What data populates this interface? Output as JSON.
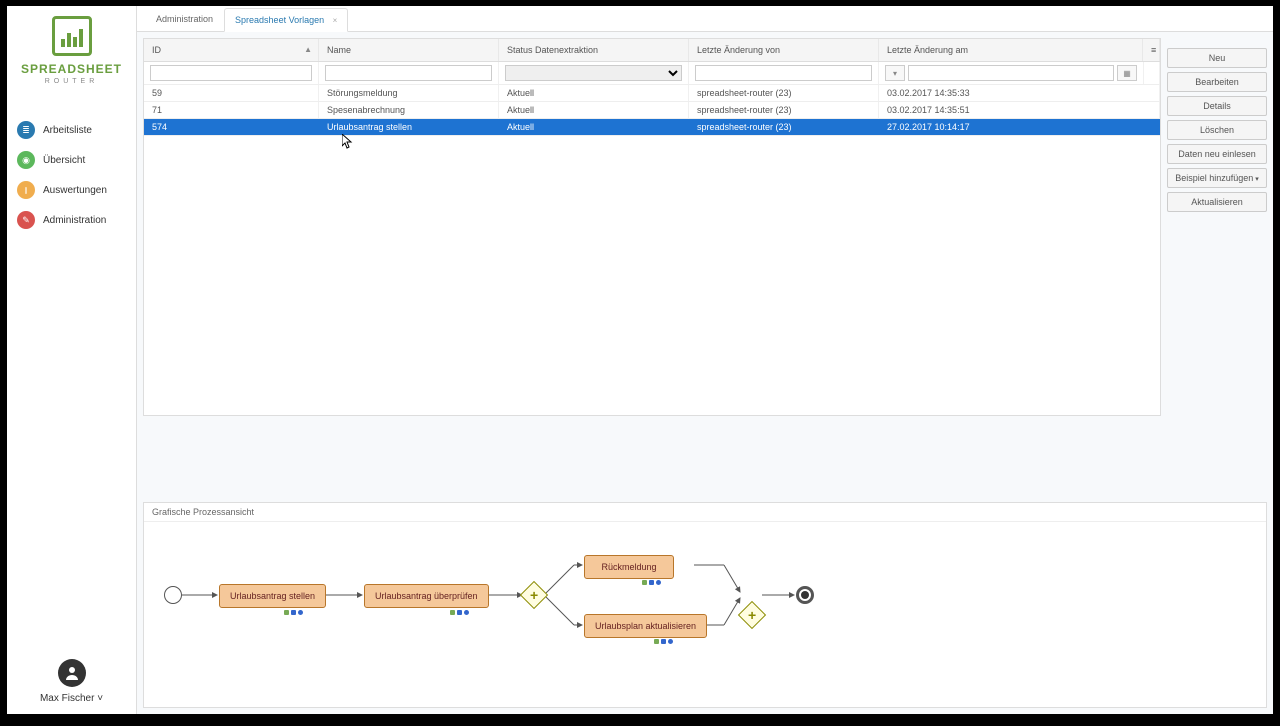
{
  "brand": {
    "line1": "SPREADSHEET",
    "line2": "ROUTER"
  },
  "nav": {
    "items": [
      {
        "label": "Arbeitsliste",
        "icon": "list"
      },
      {
        "label": "Übersicht",
        "icon": "over"
      },
      {
        "label": "Auswertungen",
        "icon": "aus"
      },
      {
        "label": "Administration",
        "icon": "admin"
      }
    ]
  },
  "user": {
    "name": "Max Fischer"
  },
  "tabs": [
    {
      "label": "Administration",
      "active": false,
      "closable": false
    },
    {
      "label": "Spreadsheet Vorlagen",
      "active": true,
      "closable": true
    }
  ],
  "grid": {
    "columns": {
      "id": "ID",
      "name": "Name",
      "status": "Status Datenextraktion",
      "von": "Letzte Änderung von",
      "am": "Letzte Änderung am"
    },
    "rows": [
      {
        "id": "59",
        "name": "Störungsmeldung",
        "status": "Aktuell",
        "von": "spreadsheet-router (23)",
        "am": "03.02.2017 14:35:33",
        "selected": false
      },
      {
        "id": "71",
        "name": "Spesenabrechnung",
        "status": "Aktuell",
        "von": "spreadsheet-router (23)",
        "am": "03.02.2017 14:35:51",
        "selected": false
      },
      {
        "id": "574",
        "name": "Urlaubsantrag stellen",
        "status": "Aktuell",
        "von": "spreadsheet-router (23)",
        "am": "27.02.2017 10:14:17",
        "selected": true
      }
    ]
  },
  "actions": {
    "neu": "Neu",
    "bearbeiten": "Bearbeiten",
    "details": "Details",
    "loeschen": "Löschen",
    "daten": "Daten neu einlesen",
    "beispiel": "Beispiel hinzufügen",
    "aktualisieren": "Aktualisieren"
  },
  "process": {
    "title": "Grafische Prozessansicht",
    "tasks": {
      "t1": "Urlaubsantrag stellen",
      "t2": "Urlaubsantrag überprüfen",
      "t3": "Rückmeldung",
      "t4": "Urlaubsplan aktualisieren"
    }
  }
}
